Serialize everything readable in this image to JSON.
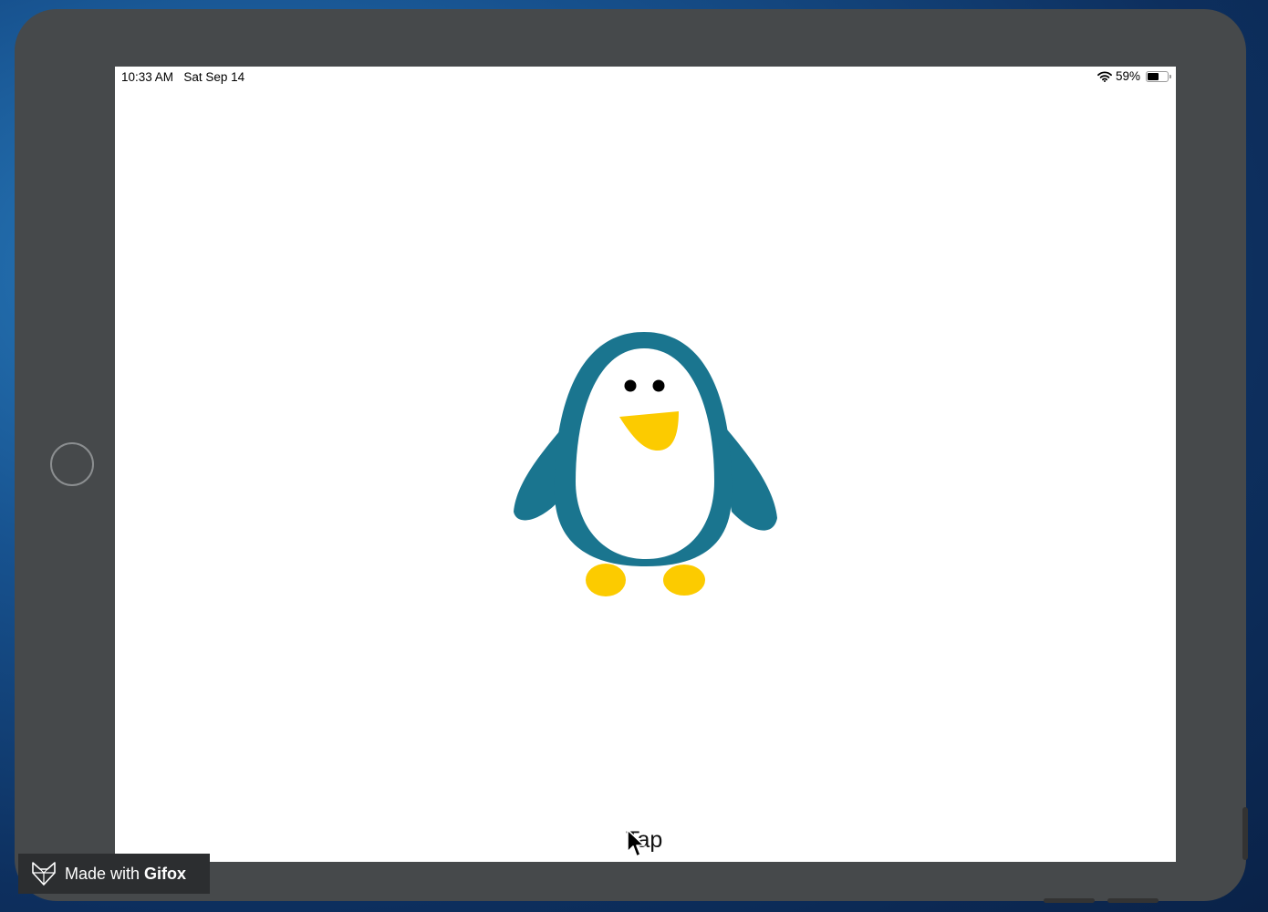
{
  "status_bar": {
    "time": "10:33 AM",
    "date": "Sat Sep 14",
    "battery_percent": "59%",
    "battery_level": 0.59
  },
  "main": {
    "tap_label": "Tap"
  },
  "watermark": {
    "prefix": "Made with",
    "brand": "Gifox"
  },
  "colors": {
    "penguin_body": "#1a758f",
    "penguin_beak_feet": "#fccb00",
    "penguin_belly": "#ffffff",
    "device_bezel": "#46494b"
  },
  "icons": [
    "wifi-icon",
    "battery-icon",
    "home-button",
    "pointer-cursor-icon",
    "gifox-logo-icon"
  ]
}
